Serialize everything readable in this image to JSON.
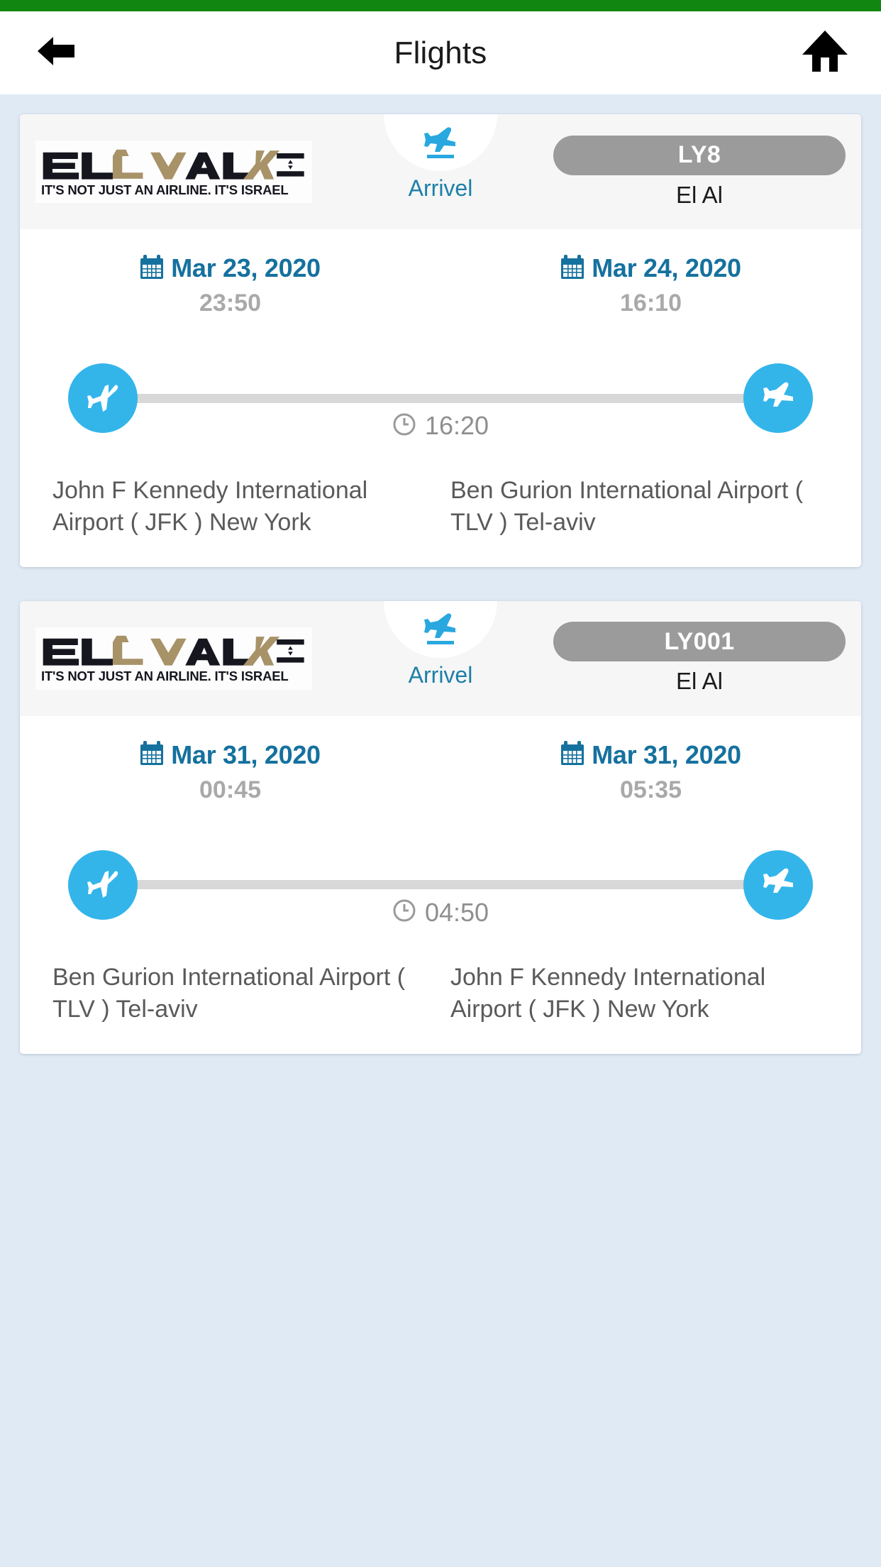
{
  "colors": {
    "status_bar": "#118712",
    "page_background": "#dfeaf5",
    "accent_blue": "#33b5ea",
    "date_blue": "#15719e",
    "arrival_label": "#1c7fa8",
    "pill_gray": "#9b9b9b",
    "time_gray": "#a9a9a9",
    "airport_gray": "#5a5a5a"
  },
  "header": {
    "title": "Flights",
    "back_icon": "back-arrow-icon",
    "home_icon": "home-icon"
  },
  "airline": {
    "logo_text_en": "EL AL",
    "logo_text_he": "אל על",
    "tagline": "IT'S NOT JUST AN AIRLINE. IT'S ISRAEL"
  },
  "flights": [
    {
      "status_label": "Arrivel",
      "status_icon": "plane-landing-icon",
      "flight_number": "LY8",
      "airline_name": "El Al",
      "departure": {
        "date": "Mar 23, 2020",
        "time": "23:50",
        "airport": "John F Kennedy International Airport ( JFK ) New York",
        "icon": "plane-departure-icon"
      },
      "arrival": {
        "date": "Mar 24, 2020",
        "time": "16:10",
        "airport": "Ben Gurion International Airport ( TLV ) Tel-aviv",
        "icon": "plane-arrival-icon"
      },
      "duration": "16:20",
      "duration_icon": "clock-icon",
      "calendar_icon": "calendar-icon"
    },
    {
      "status_label": "Arrivel",
      "status_icon": "plane-landing-icon",
      "flight_number": "LY001",
      "airline_name": "El Al",
      "departure": {
        "date": "Mar 31, 2020",
        "time": "00:45",
        "airport": "Ben Gurion International Airport ( TLV ) Tel-aviv",
        "icon": "plane-departure-icon"
      },
      "arrival": {
        "date": "Mar 31, 2020",
        "time": "05:35",
        "airport": "John F Kennedy International Airport ( JFK ) New York",
        "icon": "plane-arrival-icon"
      },
      "duration": "04:50",
      "duration_icon": "clock-icon",
      "calendar_icon": "calendar-icon"
    }
  ]
}
